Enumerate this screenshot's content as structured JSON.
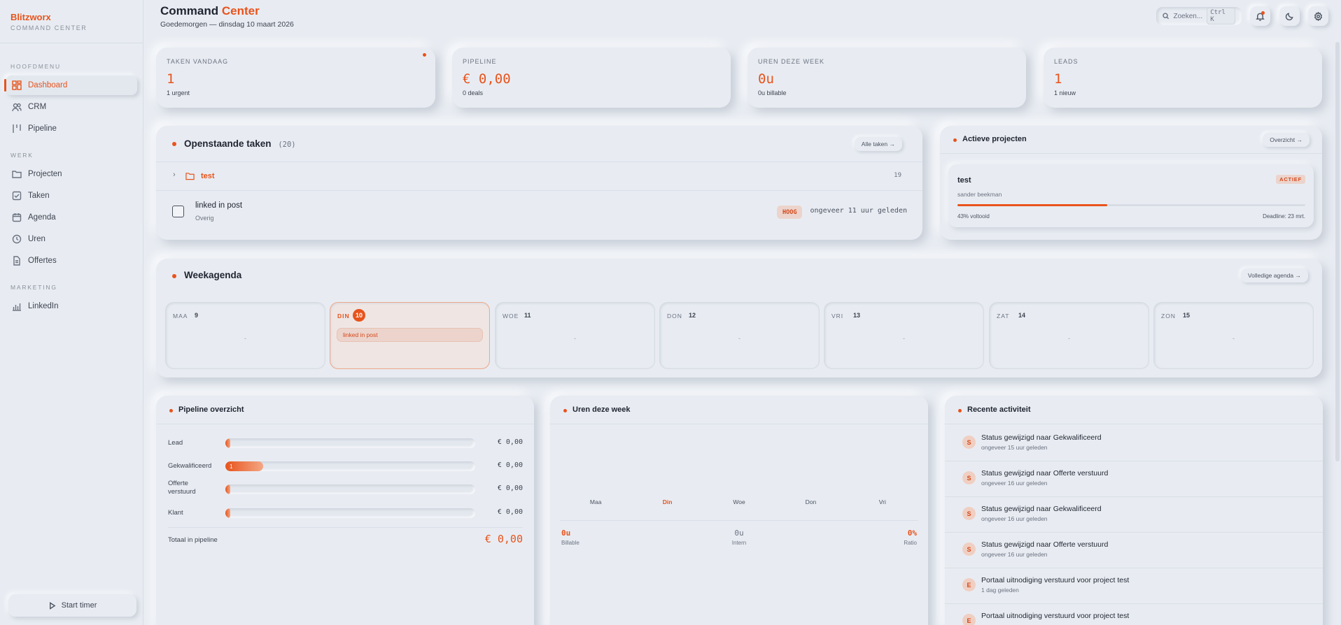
{
  "brand": {
    "name": "Blitzworx",
    "sub": "COMMAND CENTER"
  },
  "sidebar": {
    "sections": [
      {
        "title": "HOOFDMENU",
        "items": [
          {
            "label": "Dashboard",
            "icon": "dashboard-icon",
            "active": true
          },
          {
            "label": "CRM",
            "icon": "users-icon"
          },
          {
            "label": "Pipeline",
            "icon": "pipeline-icon"
          }
        ]
      },
      {
        "title": "WERK",
        "items": [
          {
            "label": "Projecten",
            "icon": "folder-icon"
          },
          {
            "label": "Taken",
            "icon": "task-icon"
          },
          {
            "label": "Agenda",
            "icon": "calendar-icon"
          },
          {
            "label": "Uren",
            "icon": "clock-icon"
          },
          {
            "label": "Offertes",
            "icon": "document-icon"
          }
        ]
      },
      {
        "title": "MARKETING",
        "items": [
          {
            "label": "LinkedIn",
            "icon": "chart-icon"
          }
        ]
      }
    ],
    "timer_label": "Start timer"
  },
  "header": {
    "title_main": "Command",
    "title_accent": "Center",
    "subtitle": "Goedemorgen — dinsdag 10 maart 2026",
    "search_placeholder": "Zoeken...",
    "search_shortcut": "Ctrl K"
  },
  "stats": [
    {
      "label": "TAKEN VANDAAG",
      "value": "1",
      "sub": "1 urgent"
    },
    {
      "label": "PIPELINE",
      "value": "€ 0,00",
      "sub": "0 deals"
    },
    {
      "label": "UREN DEZE WEEK",
      "value": "0u",
      "sub": "0u billable"
    },
    {
      "label": "LEADS",
      "value": "1",
      "sub": "1 nieuw"
    }
  ],
  "tasks": {
    "title": "Openstaande taken",
    "count": "(20)",
    "button": "Alle taken →",
    "group": {
      "name": "test",
      "count": "19"
    },
    "task": {
      "title": "linked in post",
      "category": "Overig",
      "priority": "HOOG",
      "time": "ongeveer 11 uur geleden"
    }
  },
  "projects": {
    "title": "Actieve projecten",
    "button": "Overzicht →",
    "item": {
      "name": "test",
      "owner": "sander beekman",
      "status": "ACTIEF",
      "progress": 43,
      "progress_label": "43% voltooid",
      "deadline": "Deadline: 23 mrt."
    }
  },
  "week": {
    "title": "Weekagenda",
    "button": "Volledige agenda →",
    "days": [
      {
        "name": "MAA",
        "num": "9",
        "today": false,
        "empty": "-"
      },
      {
        "name": "DIN",
        "num": "10",
        "today": true,
        "event": "linked in post"
      },
      {
        "name": "WOE",
        "num": "11",
        "today": false,
        "empty": "-"
      },
      {
        "name": "DON",
        "num": "12",
        "today": false,
        "empty": "-"
      },
      {
        "name": "VRI",
        "num": "13",
        "today": false,
        "empty": "-"
      },
      {
        "name": "ZAT",
        "num": "14",
        "today": false,
        "empty": "-"
      },
      {
        "name": "ZON",
        "num": "15",
        "today": false,
        "empty": "-"
      }
    ]
  },
  "pipeline": {
    "title": "Pipeline overzicht",
    "rows": [
      {
        "label": "Lead",
        "amount": "€ 0,00",
        "count": "",
        "fill": 0.02
      },
      {
        "label": "Gekwalificeerd",
        "amount": "€ 0,00",
        "count": "1",
        "fill": 0.15
      },
      {
        "label": "Offerte verstuurd",
        "amount": "€ 0,00",
        "count": "",
        "fill": 0.02
      },
      {
        "label": "Klant",
        "amount": "€ 0,00",
        "count": "",
        "fill": 0.02
      }
    ],
    "total_label": "Totaal in pipeline",
    "total_value": "€ 0,00"
  },
  "hours": {
    "title": "Uren deze week",
    "days": [
      "Maa",
      "Din",
      "Woe",
      "Don",
      "Vri"
    ],
    "today_index": 1,
    "billable_value": "0u",
    "billable_label": "Billable",
    "intern_value": "0u",
    "intern_label": "Intern",
    "ratio_value": "0%",
    "ratio_label": "Ratio"
  },
  "activity": {
    "title": "Recente activiteit",
    "items": [
      {
        "avatar": "S",
        "title": "Status gewijzigd naar Gekwalificeerd",
        "time": "ongeveer 15 uur geleden"
      },
      {
        "avatar": "S",
        "title": "Status gewijzigd naar Offerte verstuurd",
        "time": "ongeveer 16 uur geleden"
      },
      {
        "avatar": "S",
        "title": "Status gewijzigd naar Gekwalificeerd",
        "time": "ongeveer 16 uur geleden"
      },
      {
        "avatar": "S",
        "title": "Status gewijzigd naar Offerte verstuurd",
        "time": "ongeveer 16 uur geleden"
      },
      {
        "avatar": "E",
        "title": "Portaal uitnodiging verstuurd voor project test",
        "time": "1 dag geleden"
      },
      {
        "avatar": "E",
        "title": "Portaal uitnodiging verstuurd voor project test",
        "time": ""
      }
    ]
  },
  "colors": {
    "accent": "#e8531c",
    "background": "#e8ecf2"
  }
}
